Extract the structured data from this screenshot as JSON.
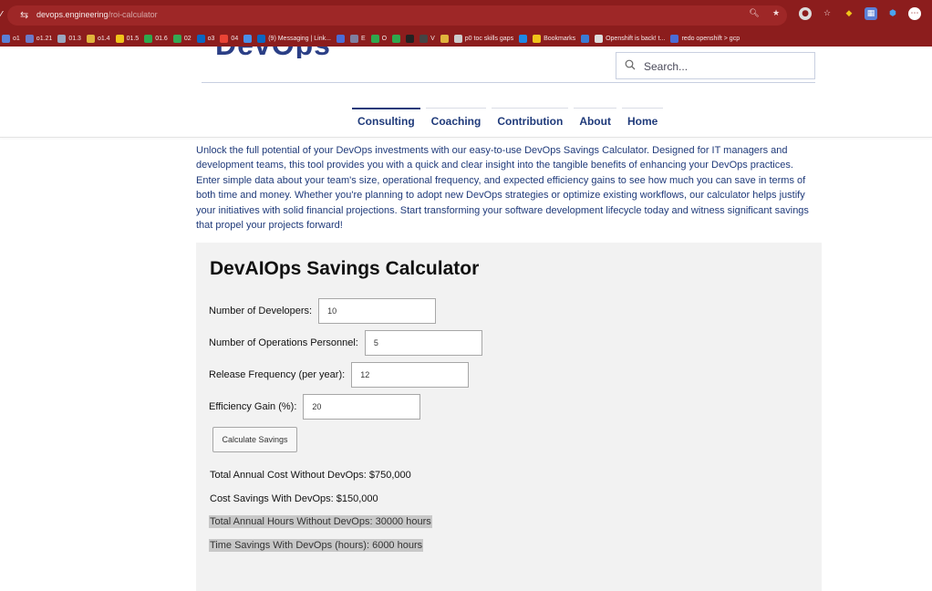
{
  "browser": {
    "url_host": "devops.engineering",
    "url_path": "/roi-calculator",
    "bookmarks": [
      {
        "label": "o1",
        "color": "#5b7fd6"
      },
      {
        "label": "o1.21",
        "color": "#6c7ac9"
      },
      {
        "label": "01.3",
        "color": "#9aa7bf"
      },
      {
        "label": "o1.4",
        "color": "#e0b43c"
      },
      {
        "label": "01.5",
        "color": "#f0c419"
      },
      {
        "label": "01.6",
        "color": "#2ea84d"
      },
      {
        "label": "02",
        "color": "#34a853"
      },
      {
        "label": "o3",
        "color": "#0a66c2"
      },
      {
        "label": "04",
        "color": "#ea4335"
      },
      {
        "label": "",
        "color": "#4a8fe7"
      },
      {
        "label": "(9) Messaging | Link...",
        "color": "#0a66c2"
      },
      {
        "label": "",
        "color": "#4b6cd6"
      },
      {
        "label": "E",
        "color": "#7f7fa0"
      },
      {
        "label": "O",
        "color": "#2ea84d"
      },
      {
        "label": "",
        "color": "#2ea84d"
      },
      {
        "label": "",
        "color": "#222222"
      },
      {
        "label": "V",
        "color": "#444444"
      },
      {
        "label": "",
        "color": "#e0b43c"
      },
      {
        "label": "p0 toc skills gaps",
        "color": "#cccccc"
      },
      {
        "label": "",
        "color": "#1e88e5"
      },
      {
        "label": "Bookmarks",
        "color": "#f0c419"
      },
      {
        "label": "",
        "color": "#3a7bd5"
      },
      {
        "label": "Openshift is back! t...",
        "color": "#dddddd"
      },
      {
        "label": "redo openshift > gcp",
        "color": "#4b6cd6"
      }
    ]
  },
  "site": {
    "logo_text": "DevOps Engineering",
    "search_placeholder": "Search...",
    "nav": [
      "Consulting",
      "Coaching",
      "Contribution",
      "About",
      "Home"
    ],
    "intro": "Unlock the full potential of your DevOps investments with our easy-to-use DevOps Savings Calculator. Designed for IT managers and development teams, this tool provides you with a quick and clear insight into the tangible benefits of enhancing your DevOps practices. Enter simple data about your team's size, operational frequency, and expected efficiency gains to see how much you can save in terms of both time and money. Whether you're planning to adopt new DevOps strategies or optimize existing workflows, our calculator helps justify your initiatives with solid financial projections. Start transforming your software development lifecycle today and witness significant savings that propel your projects forward!"
  },
  "calculator": {
    "title": "DevAIOps Savings Calculator",
    "fields": [
      {
        "label": "Number of Developers:",
        "value": "10"
      },
      {
        "label": "Number of Operations Personnel:",
        "value": "5"
      },
      {
        "label": "Release Frequency (per year):",
        "value": "12"
      },
      {
        "label": "Efficiency Gain (%):",
        "value": "20"
      }
    ],
    "button_label": "Calculate Savings",
    "results": [
      "Total Annual Cost Without DevOps: $750,000",
      "Cost Savings With DevOps: $150,000",
      "Total Annual Hours Without DevOps: 30000 hours",
      "Time Savings With DevOps (hours): 6000 hours"
    ]
  }
}
